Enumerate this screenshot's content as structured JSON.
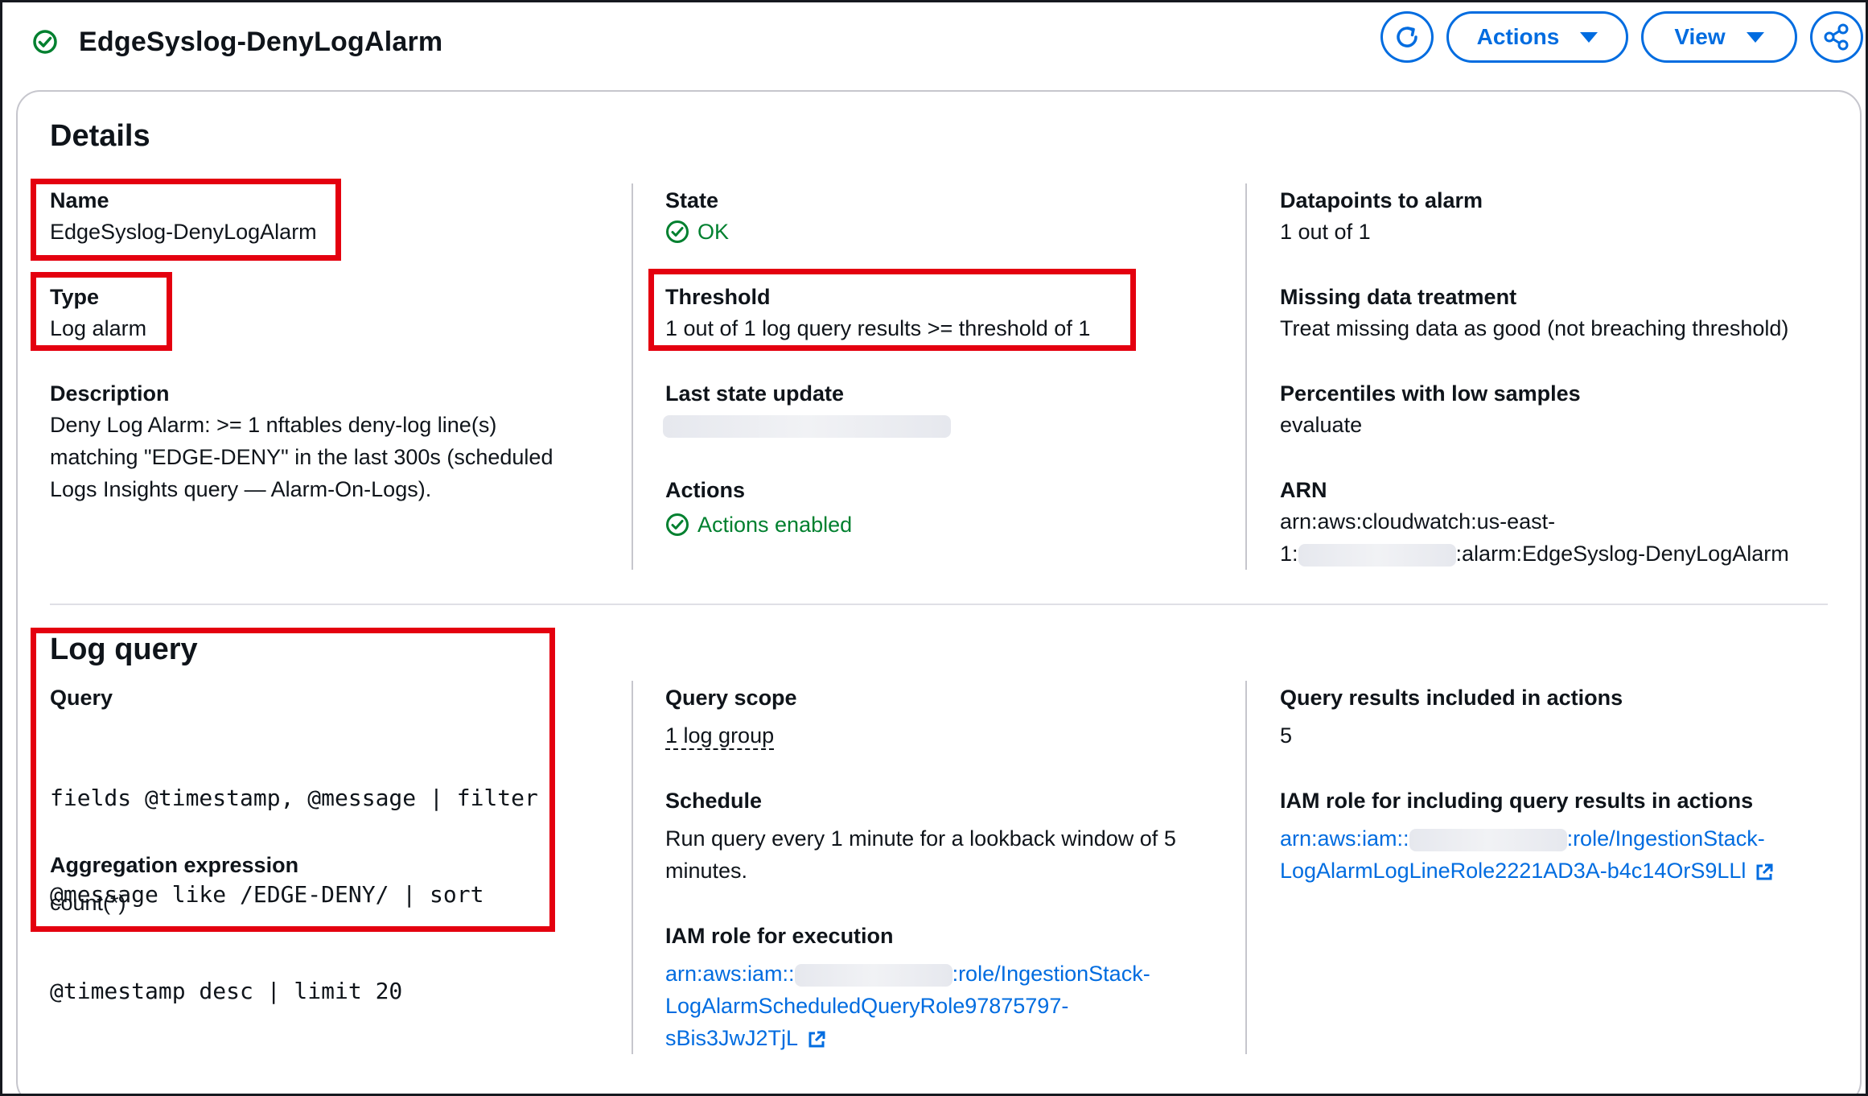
{
  "header": {
    "title": "EdgeSyslog-DenyLogAlarm",
    "actions_label": "Actions",
    "view_label": "View"
  },
  "details": {
    "heading": "Details",
    "name_label": "Name",
    "name_value": "EdgeSyslog-DenyLogAlarm",
    "type_label": "Type",
    "type_value": "Log alarm",
    "description_label": "Description",
    "description_lines": [
      "Deny Log Alarm: >= 1 nftables deny-log line(s)",
      "matching \"EDGE-DENY\" in the last 300s (scheduled",
      "Logs Insights query — Alarm-On-Logs)."
    ],
    "state_label": "State",
    "state_value": "OK",
    "threshold_label": "Threshold",
    "threshold_value": "1 out of 1 log query results >= threshold of 1",
    "last_update_label": "Last state update",
    "actions_label": "Actions",
    "actions_value": "Actions enabled",
    "datapoints_label": "Datapoints to alarm",
    "datapoints_value": "1 out of 1",
    "missing_label": "Missing data treatment",
    "missing_value": "Treat missing data as good (not breaching threshold)",
    "percentiles_label": "Percentiles with low samples",
    "percentiles_value": "evaluate",
    "arn_label": "ARN",
    "arn_line1": "arn:aws:cloudwatch:us-east-",
    "arn_line2_prefix": "1:",
    "arn_line2_suffix": ":alarm:EdgeSyslog-DenyLogAlarm"
  },
  "log_query": {
    "heading": "Log query",
    "query_label": "Query",
    "query_lines": [
      "fields @timestamp, @message | filter",
      "@message like /EDGE-DENY/ | sort",
      "@timestamp desc | limit 20"
    ],
    "aggregation_label": "Aggregation expression",
    "aggregation_value": "count(*)",
    "scope_label": "Query scope",
    "scope_value": "1 log group",
    "schedule_label": "Schedule",
    "schedule_lines": [
      "Run query every 1 minute for a lookback window of 5",
      "minutes."
    ],
    "exec_role_label": "IAM role for execution",
    "exec_role_prefix": "arn:aws:iam::",
    "exec_role_line1_suffix": ":role/IngestionStack-",
    "exec_role_line2": "LogAlarmScheduledQueryRole97875797-",
    "exec_role_line3": "sBis3JwJ2TjL",
    "results_label": "Query results included in actions",
    "results_value": "5",
    "results_role_label": "IAM role for including query results in actions",
    "results_role_prefix": "arn:aws:iam::",
    "results_role_line1_suffix": ":role/IngestionStack-",
    "results_role_line2": "LogAlarmLogLineRole2221AD3A-b4c14OrS9LLl"
  },
  "colors": {
    "link": "#006ce0",
    "success": "#00802f",
    "highlight": "#e4000f"
  },
  "icons": [
    "check-circle-icon",
    "refresh-icon",
    "caret-down-icon",
    "share-icon",
    "external-link-icon"
  ]
}
